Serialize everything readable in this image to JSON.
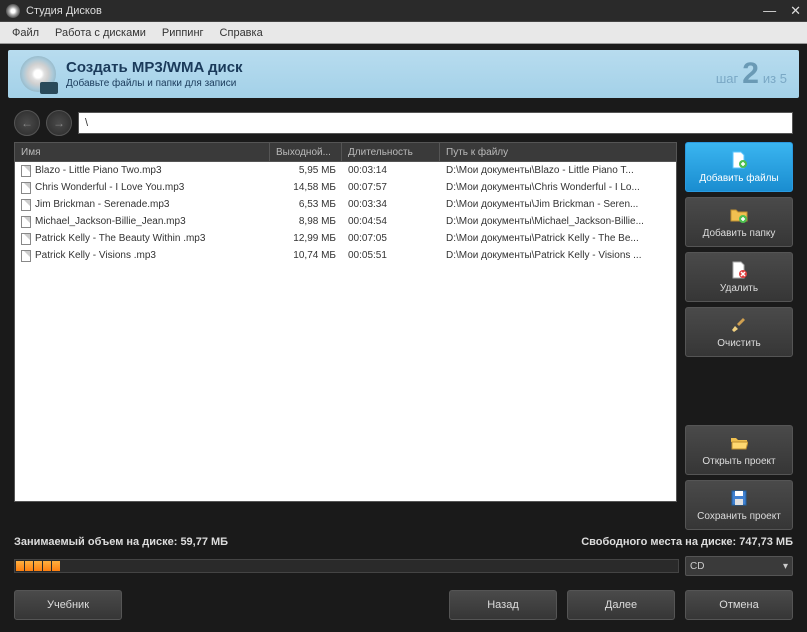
{
  "titlebar": {
    "title": "Студия Дисков"
  },
  "menu": {
    "file": "Файл",
    "disc": "Работа с дисками",
    "ripping": "Риппинг",
    "help": "Справка"
  },
  "banner": {
    "title": "Создать MP3/WMA диск",
    "subtitle": "Добавьте файлы и папки для записи",
    "step_prefix": "шаг",
    "step_num": "2",
    "step_suffix": "из 5"
  },
  "path": "\\",
  "columns": {
    "name": "Имя",
    "size": "Выходной...",
    "duration": "Длительность",
    "path": "Путь к файлу"
  },
  "files": [
    {
      "name": "Blazo - Little Piano Two.mp3",
      "size": "5,95 МБ",
      "duration": "00:03:14",
      "path": "D:\\Мои документы\\Blazo - Little Piano T..."
    },
    {
      "name": "Chris Wonderful - I Love You.mp3",
      "size": "14,58 МБ",
      "duration": "00:07:57",
      "path": "D:\\Мои документы\\Chris Wonderful - I Lo..."
    },
    {
      "name": "Jim Brickman - Serenade.mp3",
      "size": "6,53 МБ",
      "duration": "00:03:34",
      "path": "D:\\Мои документы\\Jim Brickman - Seren..."
    },
    {
      "name": "Michael_Jackson-Billie_Jean.mp3",
      "size": "8,98 МБ",
      "duration": "00:04:54",
      "path": "D:\\Мои документы\\Michael_Jackson-Billie..."
    },
    {
      "name": "Patrick Kelly - The Beauty Within .mp3",
      "size": "12,99 МБ",
      "duration": "00:07:05",
      "path": "D:\\Мои документы\\Patrick Kelly - The Be..."
    },
    {
      "name": "Patrick Kelly - Visions .mp3",
      "size": "10,74 МБ",
      "duration": "00:05:51",
      "path": "D:\\Мои документы\\Patrick Kelly - Visions ..."
    }
  ],
  "sidebar": {
    "add_files": "Добавить файлы",
    "add_folder": "Добавить папку",
    "delete": "Удалить",
    "clear": "Очистить",
    "open_project": "Открыть проект",
    "save_project": "Сохранить проект"
  },
  "status": {
    "used_label": "Занимаемый объем на диске:",
    "used_value": "59,77 МБ",
    "free_label": "Свободного места на диске:",
    "free_value": "747,73 МБ"
  },
  "disc_type": "CD",
  "footer": {
    "tutorial": "Учебник",
    "back": "Назад",
    "next": "Далее",
    "cancel": "Отмена"
  }
}
